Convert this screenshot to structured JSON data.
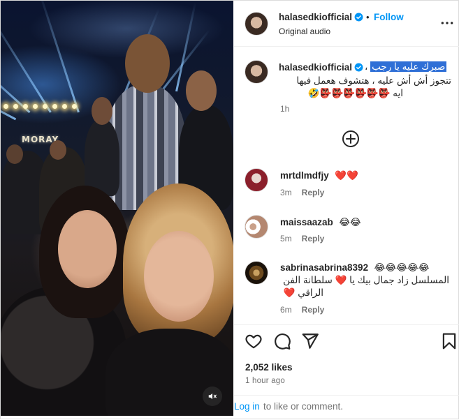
{
  "post": {
    "username": "halasedkiofficial",
    "follow_label": "Follow",
    "separator": "•",
    "audio": "Original audio",
    "more_icon": "more-horizontal-icon",
    "mute_icon": "speaker-muted-icon"
  },
  "caption": {
    "username": "halasedkiofficial",
    "highlighted": "صبرك عليه يا رجب",
    "line1_rest": "،",
    "line2": "تتجوز أش أش عليه ، هتشوف هعمل فيها",
    "line3": "ايه 👺👺👺👺👺👺🤣",
    "time": "1h",
    "load_more_icon": "plus-circle-icon"
  },
  "comments": [
    {
      "username": "mrtdlmdfjy",
      "text": "❤️❤️",
      "time": "3m",
      "reply": "Reply",
      "avatar": "avatar-red"
    },
    {
      "username": "maissaazab",
      "text": "😂😂",
      "time": "5m",
      "reply": "Reply",
      "avatar": "avatar-group"
    },
    {
      "username": "sabrinasabrina8392",
      "text_inline": "😂😂😂😂😂",
      "text_line2": "المسلسل زاد جمال بيك يا ❤️ سلطانة الفن",
      "text_line3": "الراقي ❤️",
      "time": "6m",
      "reply": "Reply",
      "avatar": "avatar-gold"
    }
  ],
  "actions": {
    "like_icon": "heart-icon",
    "comment_icon": "comment-icon",
    "share_icon": "send-icon",
    "save_icon": "bookmark-icon",
    "likes": "2,052 likes",
    "ago": "1 hour ago"
  },
  "footer": {
    "login_link": "Log in",
    "login_rest": "to like or comment."
  },
  "media": {
    "sign_text": "MORAY"
  },
  "colors": {
    "accent": "#0095f6",
    "highlight": "#2f6fd6",
    "heart": "#e0245e",
    "muted_text": "#737373"
  }
}
